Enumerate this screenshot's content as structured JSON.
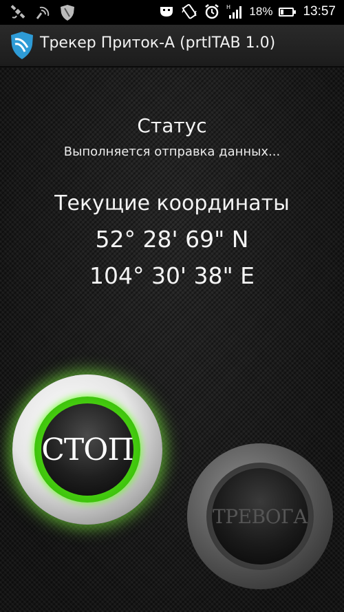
{
  "status_bar": {
    "battery_percent": "18%",
    "battery_level": 0.18,
    "time": "13:57",
    "left_icons": [
      "satellite-icon",
      "gps-signal-icon",
      "shield-icon"
    ],
    "right_icons": [
      "usb-debug-icon",
      "vibrate-icon",
      "alarm-clock-icon",
      "mobile-signal-icon",
      "battery-icon"
    ]
  },
  "titlebar": {
    "title": "Трекер Приток-А (prtITAB 1.0)",
    "icon": "app-logo-icon"
  },
  "status": {
    "label": "Статус",
    "value": "Выполняется отправка данных..."
  },
  "coordinates": {
    "label": "Текущие координаты",
    "latitude": "52° 28' 69\" N",
    "longitude": "104° 30' 38\" E"
  },
  "buttons": {
    "stop_label": "СТОП",
    "alarm_label": "ТРЕВОГА"
  },
  "colors": {
    "stop_glow": "#6cf02a",
    "alarm_text": "#555555",
    "app_icon": "#2e9bd6"
  }
}
